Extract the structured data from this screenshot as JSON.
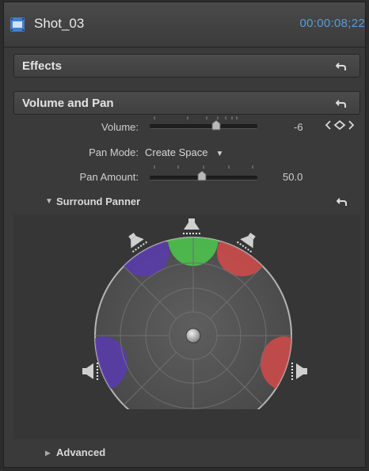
{
  "header": {
    "clip_name": "Shot_03",
    "timecode": "00:00:08;22"
  },
  "effects": {
    "title": "Effects"
  },
  "volume_pan": {
    "title": "Volume and Pan",
    "volume_label": "Volume:",
    "volume_value": "-6",
    "pan_mode_label": "Pan Mode:",
    "pan_mode_value": "Create Space",
    "pan_amount_label": "Pan Amount:",
    "pan_amount_value": "50.0"
  },
  "surround": {
    "title": "Surround Panner",
    "advanced_label": "Advanced"
  },
  "colors": {
    "accent_timecode": "#5b9bd8",
    "center_speaker": "#4cc14c",
    "front_speakers": "#d24a4a",
    "left_speakers": "#5a3bb0"
  }
}
